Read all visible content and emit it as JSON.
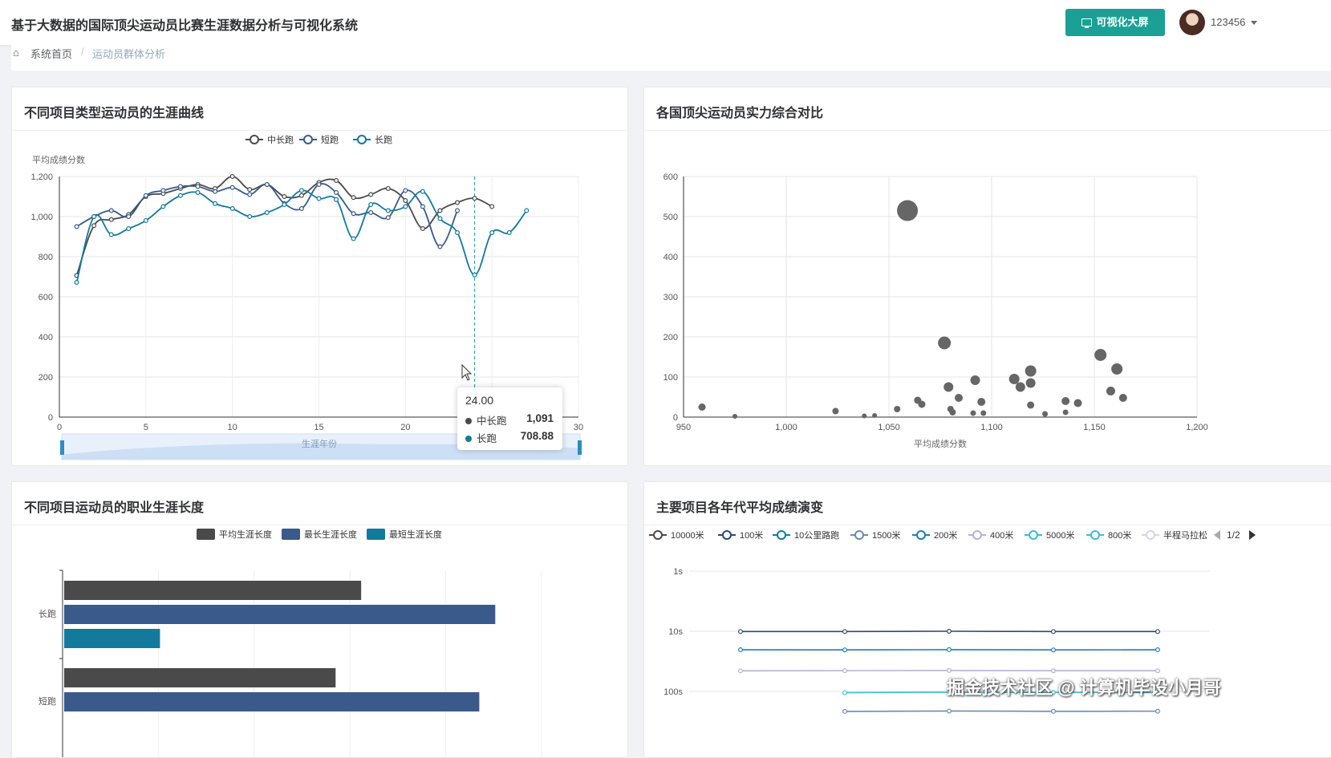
{
  "header": {
    "app_title": "基于大数据的国际顶尖运动员比赛生涯数据分析与可视化系统",
    "screen_button": "可视化大屏",
    "username": "123456"
  },
  "breadcrumb": {
    "home": "系统首页",
    "separator": "/",
    "current": "运动员群体分析"
  },
  "colors": {
    "accent": "#1aa094",
    "series_dark": "#4a4a4a",
    "series_navy": "#3a5a8c",
    "series_teal": "#137a9e"
  },
  "cards": {
    "career_curve": {
      "title": "不同项目类型运动员的生涯曲线",
      "legend": [
        "中长跑",
        "短跑",
        "长跑"
      ],
      "ylabel": "平均成绩分数",
      "xlabel": "生涯年份",
      "tooltip": {
        "x": "24.00",
        "rows": [
          {
            "name": "中长跑",
            "value": "1,091"
          },
          {
            "name": "长跑",
            "value": "708.88"
          }
        ]
      }
    },
    "country_compare": {
      "title": "各国顶尖运动员实力综合对比",
      "xlabel": "平均成绩分数"
    },
    "career_length": {
      "title": "不同项目运动员的职业生涯长度",
      "legend": [
        "平均生涯长度",
        "最长生涯长度",
        "最短生涯长度"
      ]
    },
    "era_evolution": {
      "title": "主要项目各年代平均成绩演变",
      "legend": [
        "10000米",
        "100米",
        "10公里路跑",
        "1500米",
        "200米",
        "400米",
        "5000米",
        "800米",
        "半程马拉松"
      ],
      "pager": "1/2"
    }
  },
  "watermark": "掘金技术社区 @ 计算机毕设小月哥",
  "chart_data": [
    {
      "type": "line",
      "title": "不同项目类型运动员的生涯曲线",
      "ylabel": "平均成绩分数",
      "xlabel": "生涯年份",
      "xlim": [
        0,
        30
      ],
      "ylim": [
        0,
        1200
      ],
      "x_ticks": [
        0,
        5,
        10,
        15,
        20,
        25,
        30
      ],
      "y_ticks": [
        0,
        200,
        400,
        600,
        800,
        1000,
        1200
      ],
      "y_tick_labels": [
        "0",
        "200",
        "400",
        "600",
        "800",
        "1,000",
        "1,200"
      ],
      "series": [
        {
          "name": "中长跑",
          "color": "#4a4a4a",
          "x": [
            1,
            2,
            3,
            4,
            5,
            6,
            7,
            8,
            9,
            10,
            11,
            12,
            13,
            14,
            15,
            16,
            17,
            18,
            19,
            20,
            21,
            22,
            23,
            24,
            25
          ],
          "y": [
            706,
            955,
            985,
            1010,
            1100,
            1115,
            1140,
            1160,
            1140,
            1200,
            1135,
            1160,
            1100,
            1105,
            1170,
            1180,
            1095,
            1110,
            1140,
            1080,
            940,
            1030,
            1070,
            1091,
            1050
          ]
        },
        {
          "name": "短跑",
          "color": "#3a5a8c",
          "x": [
            1,
            2,
            3,
            4,
            5,
            6,
            7,
            8,
            9,
            10,
            11,
            12,
            13,
            14,
            15,
            16,
            17,
            18,
            19,
            20,
            21,
            22,
            23
          ],
          "y": [
            950,
            1000,
            1030,
            1000,
            1105,
            1130,
            1150,
            1150,
            1125,
            1145,
            1110,
            1160,
            1065,
            1040,
            1160,
            1120,
            1015,
            1020,
            995,
            1130,
            1050,
            850,
            1030
          ]
        },
        {
          "name": "长跑",
          "color": "#137a9e",
          "x": [
            1,
            2,
            3,
            4,
            5,
            6,
            7,
            8,
            9,
            10,
            11,
            12,
            13,
            14,
            15,
            16,
            17,
            18,
            19,
            20,
            21,
            22,
            23,
            24,
            25,
            26,
            27
          ],
          "y": [
            672,
            1000,
            910,
            940,
            980,
            1050,
            1105,
            1120,
            1065,
            1040,
            1000,
            1020,
            1060,
            1130,
            1090,
            1085,
            890,
            1060,
            1030,
            1050,
            1125,
            990,
            920,
            708.88,
            920,
            920,
            1030
          ]
        }
      ]
    },
    {
      "type": "scatter",
      "title": "各国顶尖运动员实力综合对比",
      "xlabel": "平均成绩分数",
      "xlim": [
        950,
        1200
      ],
      "ylim": [
        0,
        600
      ],
      "x_ticks": [
        950,
        1000,
        1050,
        1100,
        1150,
        1200
      ],
      "x_tick_labels": [
        "950",
        "1,000",
        "1,050",
        "1,100",
        "1,150",
        "1,200"
      ],
      "y_ticks": [
        0,
        100,
        200,
        300,
        400,
        500,
        600
      ],
      "points": [
        {
          "x": 959,
          "y": 25,
          "size": 9
        },
        {
          "x": 975,
          "y": 2,
          "size": 6
        },
        {
          "x": 1024,
          "y": 15,
          "size": 8
        },
        {
          "x": 1038,
          "y": 3,
          "size": 6
        },
        {
          "x": 1043,
          "y": 4,
          "size": 6
        },
        {
          "x": 1054,
          "y": 20,
          "size": 8
        },
        {
          "x": 1059,
          "y": 515,
          "size": 26
        },
        {
          "x": 1064,
          "y": 42,
          "size": 9
        },
        {
          "x": 1066,
          "y": 32,
          "size": 9
        },
        {
          "x": 1077,
          "y": 185,
          "size": 16
        },
        {
          "x": 1079,
          "y": 75,
          "size": 12
        },
        {
          "x": 1080,
          "y": 20,
          "size": 8
        },
        {
          "x": 1081,
          "y": 12,
          "size": 8
        },
        {
          "x": 1084,
          "y": 48,
          "size": 10
        },
        {
          "x": 1091,
          "y": 10,
          "size": 7
        },
        {
          "x": 1092,
          "y": 92,
          "size": 12
        },
        {
          "x": 1095,
          "y": 38,
          "size": 10
        },
        {
          "x": 1096,
          "y": 10,
          "size": 7
        },
        {
          "x": 1111,
          "y": 95,
          "size": 13
        },
        {
          "x": 1114,
          "y": 75,
          "size": 12
        },
        {
          "x": 1119,
          "y": 115,
          "size": 14
        },
        {
          "x": 1119,
          "y": 85,
          "size": 12
        },
        {
          "x": 1119,
          "y": 30,
          "size": 9
        },
        {
          "x": 1126,
          "y": 8,
          "size": 7
        },
        {
          "x": 1136,
          "y": 40,
          "size": 10
        },
        {
          "x": 1136,
          "y": 12,
          "size": 7
        },
        {
          "x": 1142,
          "y": 35,
          "size": 10
        },
        {
          "x": 1153,
          "y": 155,
          "size": 15
        },
        {
          "x": 1158,
          "y": 65,
          "size": 11
        },
        {
          "x": 1161,
          "y": 120,
          "size": 14
        },
        {
          "x": 1164,
          "y": 48,
          "size": 10
        }
      ]
    },
    {
      "type": "bar",
      "orientation": "horizontal",
      "title": "不同项目运动员的职业生涯长度",
      "categories": [
        "长跑",
        "短跑"
      ],
      "series": [
        {
          "name": "平均生涯长度",
          "color": "#4a4a4a",
          "values": [
            9.3,
            8.5
          ]
        },
        {
          "name": "最长生涯长度",
          "color": "#3a5a8c",
          "values": [
            13.5,
            13.0
          ]
        },
        {
          "name": "最短生涯长度",
          "color": "#137a9e",
          "values": [
            3.0,
            null
          ]
        }
      ],
      "xlim": [
        0,
        15
      ]
    },
    {
      "type": "line",
      "title": "主要项目各年代平均成绩演变",
      "y_scale": "log",
      "y_tick_labels": [
        "1s",
        "10s",
        "100s"
      ],
      "x_count": 5,
      "series": [
        {
          "name": "100米",
          "color": "#2f4a6e",
          "x": [
            0,
            1,
            2,
            3,
            4
          ],
          "y": [
            10.1,
            10.1,
            10.0,
            10.1,
            10.1
          ]
        },
        {
          "name": "200米",
          "color": "#1f7fb0",
          "x": [
            0,
            1,
            2,
            3,
            4
          ],
          "y": [
            20.3,
            20.4,
            20.2,
            20.4,
            20.3
          ]
        },
        {
          "name": "400米",
          "color": "#b8b0d8",
          "x": [
            0,
            1,
            2,
            3,
            4
          ],
          "y": [
            45.5,
            45.2,
            44.9,
            45.3,
            45.3
          ]
        },
        {
          "name": "800米",
          "color": "#3bbfd0",
          "x": [
            1,
            2,
            3,
            4
          ],
          "y": [
            105,
            103,
            104,
            104
          ]
        },
        {
          "name": "1500米",
          "color": "#6a8cb0",
          "x": [
            1,
            2,
            3,
            4
          ],
          "y": [
            215,
            212,
            214,
            213
          ]
        }
      ]
    }
  ]
}
